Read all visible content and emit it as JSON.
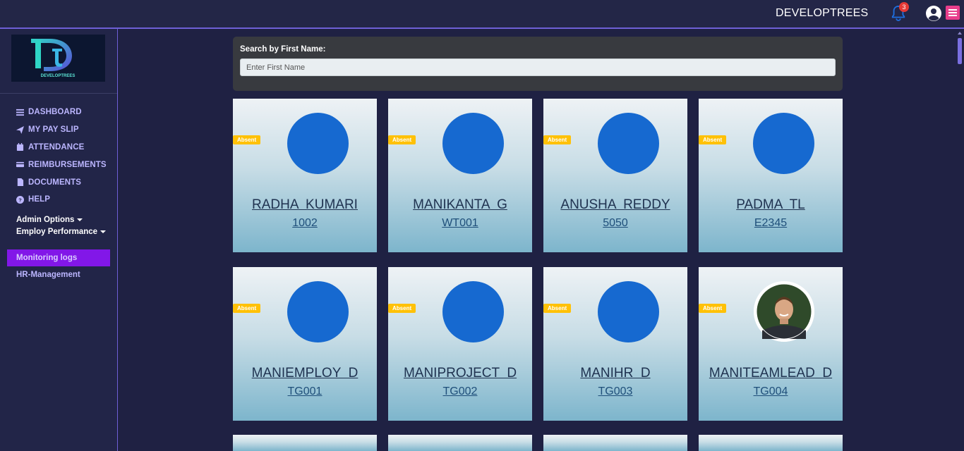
{
  "header": {
    "brand": "DEVELOPTREES",
    "notification_count": "3"
  },
  "sidebar": {
    "logo_text": "DEVELOPTREES",
    "nav": [
      {
        "label": "DASHBOARD",
        "icon": "bars-icon"
      },
      {
        "label": "MY PAY SLIP",
        "icon": "paper-plane-icon"
      },
      {
        "label": "ATTENDANCE",
        "icon": "calendar-icon"
      },
      {
        "label": "REIMBURSEMENTS",
        "icon": "credit-card-icon"
      },
      {
        "label": "DOCUMENTS",
        "icon": "file-icon"
      },
      {
        "label": "HELP",
        "icon": "question-circle-icon"
      }
    ],
    "admin_options": "Admin Options",
    "employ_performance": "Employ Performance",
    "monitoring_logs": "Monitoring logs",
    "hr_management": "HR-Management"
  },
  "search": {
    "label": "Search by First Name:",
    "placeholder": "Enter First Name"
  },
  "employees": [
    {
      "status": "Absent",
      "name": "RADHA  KUMARI",
      "code": "1002"
    },
    {
      "status": "Absent",
      "name": "MANIKANTA  G",
      "code": "WT001"
    },
    {
      "status": "Absent",
      "name": "ANUSHA  REDDY",
      "code": "5050"
    },
    {
      "status": "Absent",
      "name": "PADMA  TL",
      "code": "E2345"
    },
    {
      "status": "Absent",
      "name": "MANIEMPLOY  D",
      "code": "TG001"
    },
    {
      "status": "Absent",
      "name": "MANIPROJECT  D",
      "code": "TG002"
    },
    {
      "status": "Absent",
      "name": "MANIHR  D",
      "code": "TG003"
    },
    {
      "status": "Absent",
      "name": "MANITEAMLEAD  D",
      "code": "TG004"
    }
  ],
  "colors": {
    "avatar_blue": "#1669d0",
    "active_nav": "#8217e8",
    "absent_badge": "#ffc107"
  }
}
